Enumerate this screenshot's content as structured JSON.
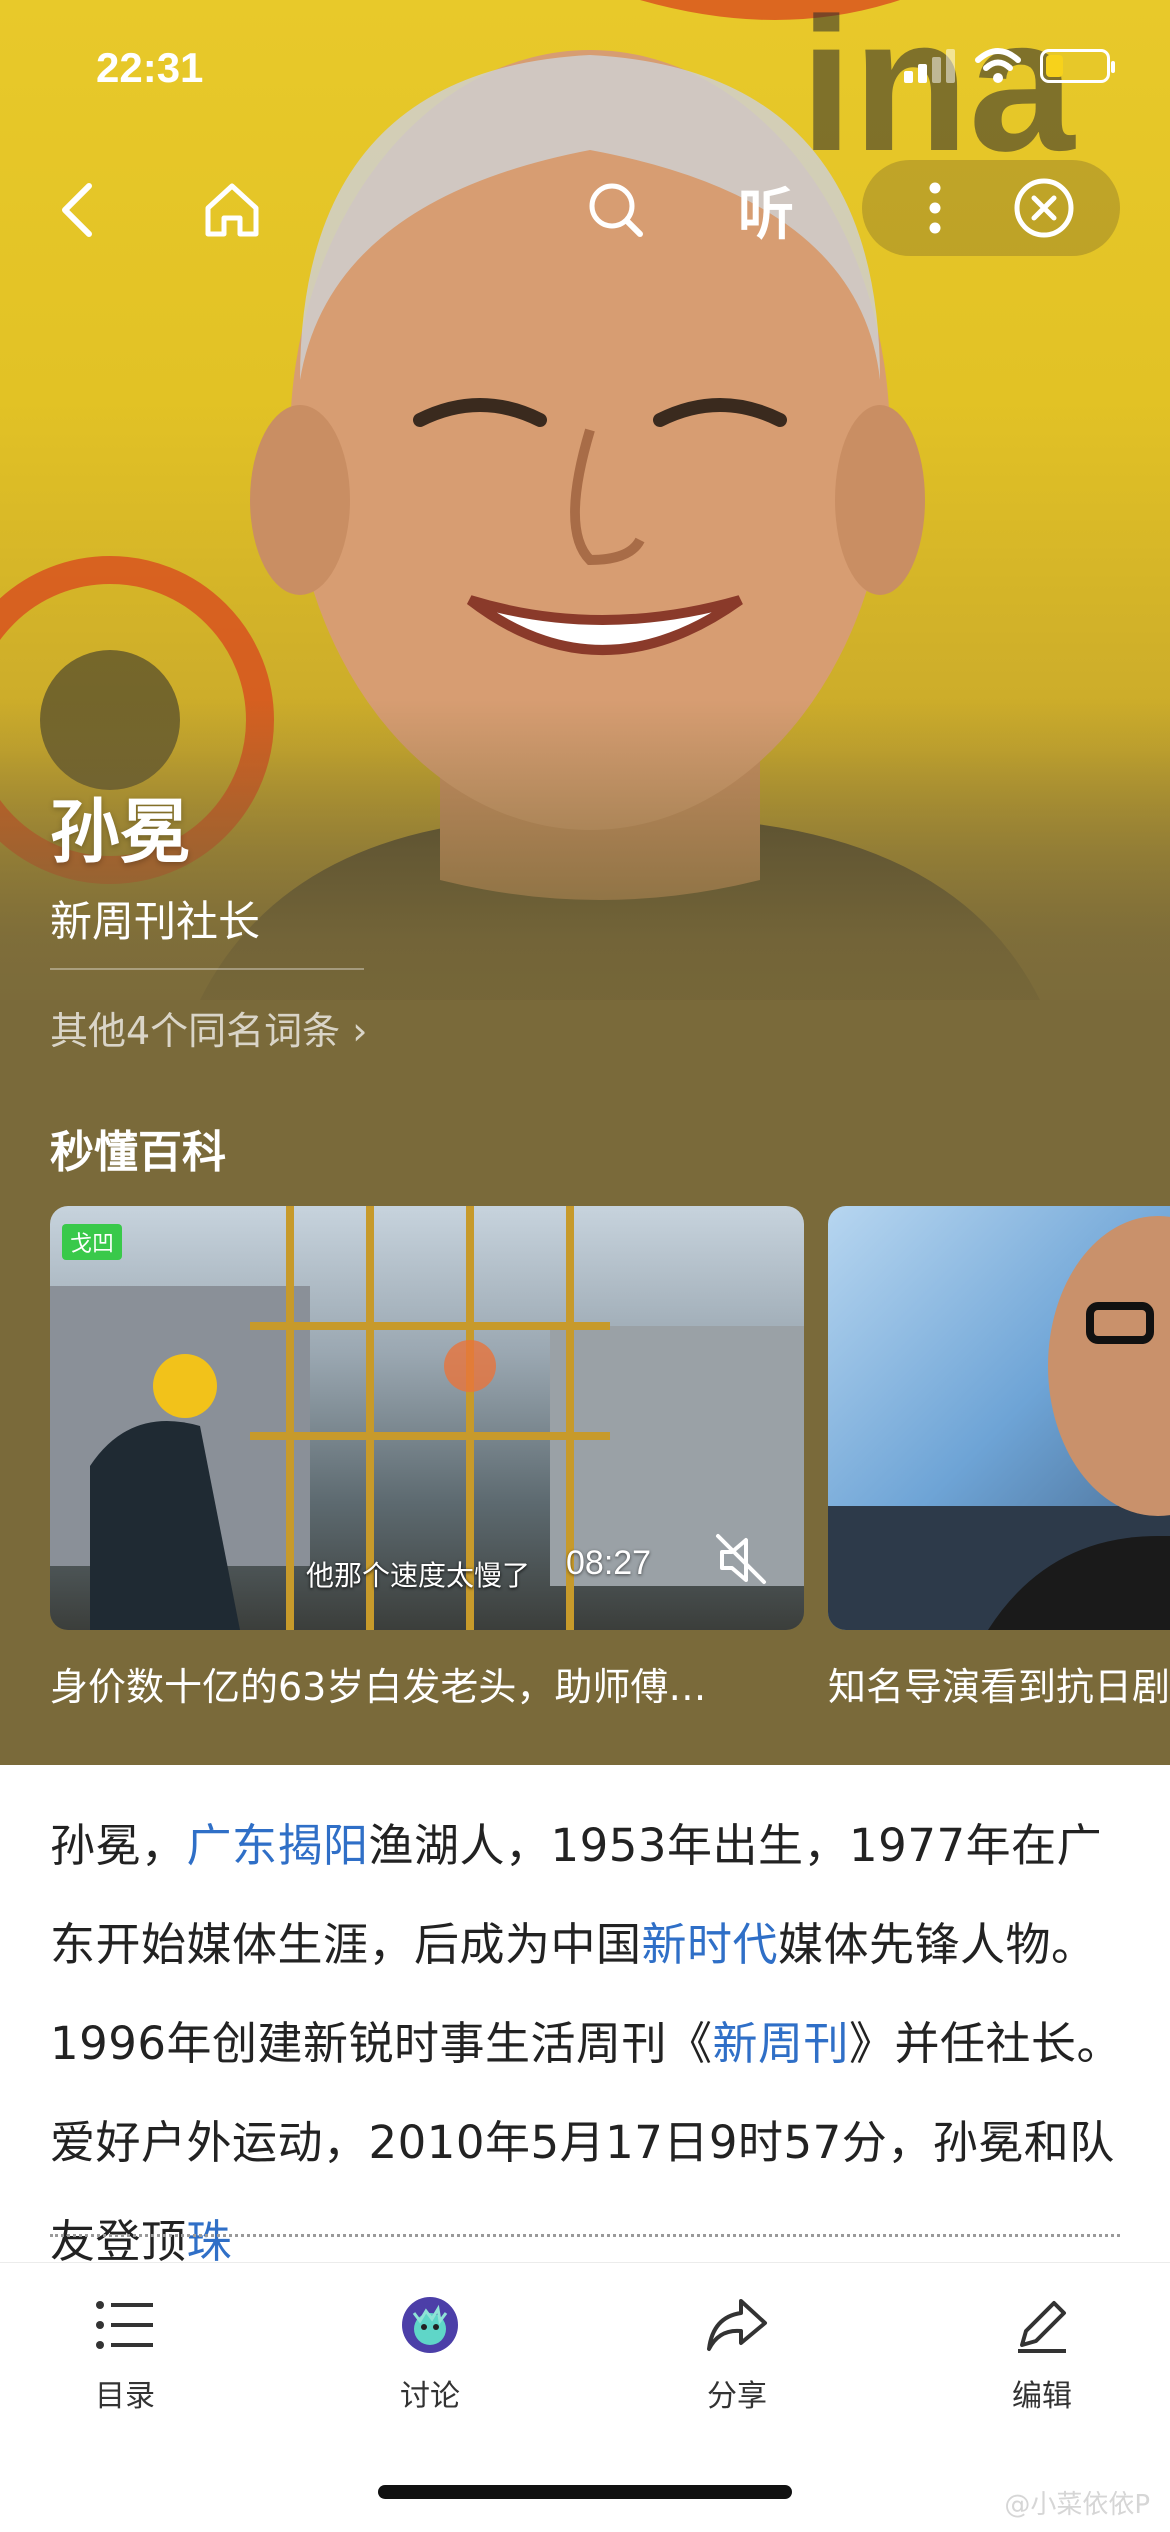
{
  "status_bar": {
    "time": "22:31",
    "battery_level": 0.3
  },
  "nav": {
    "back_icon": "chevron-left-icon",
    "home_icon": "home-icon",
    "search_icon": "search-icon",
    "listen_label": "听",
    "more_icon": "more-vertical-icon",
    "close_icon": "close-circle-icon"
  },
  "hero": {
    "name": "孙冕",
    "title": "新周刊社长",
    "same_name_link": "其他4个同名词条 ›"
  },
  "video_section": {
    "title": "秒懂百科",
    "videos": [
      {
        "badge": "戈凹",
        "subtitle": "他那个速度太慢了",
        "duration": "08:27",
        "caption": "身价数十亿的63岁白发老头，助师傅…"
      },
      {
        "caption": "知名导演看到抗日剧"
      }
    ]
  },
  "intro": {
    "segments": [
      {
        "text": "孙冕，",
        "link": false
      },
      {
        "text": "广东揭阳",
        "link": true
      },
      {
        "text": "渔湖人，1953年出生，1977年在广东开始媒体生涯，后成为中国",
        "link": false
      },
      {
        "text": "新时代",
        "link": true
      },
      {
        "text": "媒体先锋人物。1996年创建新锐时事生活周刊《",
        "link": false
      },
      {
        "text": "新周刊",
        "link": true
      },
      {
        "text": "》并任社长。爱好户外运动，2010年5月17日9时57分，孙冕和队友登顶",
        "link": false
      },
      {
        "text": "珠",
        "link": true
      }
    ]
  },
  "tabbar": [
    {
      "label": "目录",
      "icon": "list-icon"
    },
    {
      "label": "讨论",
      "icon": "discussion-avatar-icon"
    },
    {
      "label": "分享",
      "icon": "share-icon"
    },
    {
      "label": "编辑",
      "icon": "edit-icon"
    }
  ],
  "watermark": "@小菜依依P",
  "colors": {
    "link": "#2f6fc7",
    "hero_bg": "#7a6a3a",
    "text": "#222222"
  }
}
